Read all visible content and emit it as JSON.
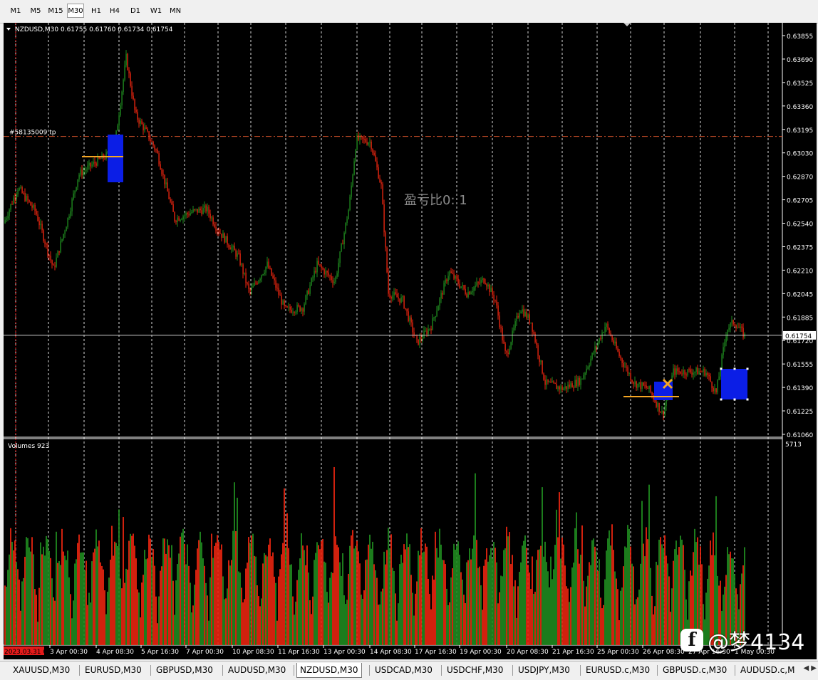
{
  "toolbar": {
    "timeframes": [
      "M1",
      "M5",
      "M15",
      "M30",
      "H1",
      "H4",
      "D1",
      "W1",
      "MN"
    ],
    "active": "M30"
  },
  "chart": {
    "symbol_header": "NZDUSD,M30  0.61755 0.61760 0.61734 0.61754",
    "price_levels": [
      "0.63855",
      "0.63690",
      "0.63525",
      "0.63360",
      "0.63195",
      "0.63030",
      "0.62870",
      "0.62705",
      "0.62540",
      "0.62375",
      "0.62210",
      "0.62045",
      "0.61885",
      "0.61720",
      "0.61555",
      "0.61390",
      "0.61225",
      "0.61060"
    ],
    "current_price": "0.61754",
    "order_label": "#58135009 tp",
    "ratio_text": "盈亏比0:  1",
    "volumes_label": "Volumes 923",
    "volume_max": "5713",
    "date_start": "2023.03.31 00:30",
    "date_labels": [
      "3 Apr 00:30",
      "4 Apr 08:30",
      "5 Apr 16:30",
      "7 Apr 00:30",
      "10 Apr 08:30",
      "11 Apr 16:30",
      "13 Apr 00:30",
      "14 Apr 08:30",
      "17 Apr 16:30",
      "19 Apr 00:30",
      "20 Apr 08:30",
      "21 Apr 16:30",
      "25 Apr 00:30",
      "26 Apr 08:30",
      "27 Apr 16:30",
      "1 May 00:30"
    ]
  },
  "colors": {
    "bull": "#1f8a1f",
    "bear": "#e8250f",
    "grid": "#ffffff",
    "box": "#0b1ee6"
  },
  "tabs": [
    "XAUUSD,M30",
    "EURUSD,M30",
    "GBPUSD,M30",
    "AUDUSD,M30",
    "NZDUSD,M30",
    "USDCAD,M30",
    "USDCHF,M30",
    "USDJPY,M30",
    "EURUSD.c,M30",
    "GBPUSD.c,M30",
    "AUDUSD.c,M"
  ],
  "active_tab": "NZDUSD,M30",
  "watermark": {
    "logo": "f",
    "text": "@梦4134"
  }
}
